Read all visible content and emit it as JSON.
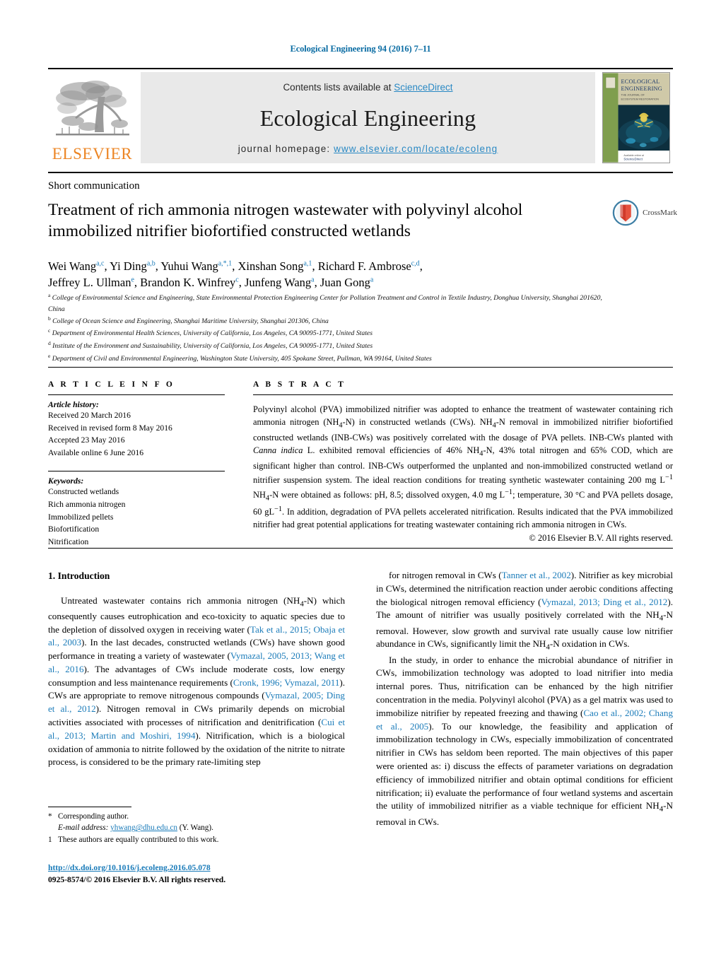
{
  "running_head": "Ecological Engineering 94 (2016) 7–11",
  "masthead": {
    "publisher_name": "ELSEVIER",
    "contents_prefix": "Contents lists available at ",
    "sciencedirect_link": "ScienceDirect",
    "journal_name": "Ecological Engineering",
    "homepage_prefix": "journal homepage: ",
    "homepage_link": "www.elsevier.com/locate/ecoleng",
    "cover_title_line1": "ECOLOGICAL",
    "cover_title_line2": "ENGINEERING"
  },
  "article": {
    "type": "Short communication",
    "title": "Treatment of rich ammonia nitrogen wastewater with polyvinyl alcohol immobilized nitrifier biofortified constructed wetlands",
    "crossmark_label": "CrossMark",
    "authors_line1": "Wei Wang<sup>a,c</sup>, Yi Ding<sup>a,b</sup>, Yuhui Wang<sup>a,*,1</sup>, Xinshan Song<sup>a,1</sup>, Richard F. Ambrose<sup>c,d</sup>,",
    "authors_line2": "Jeffrey L. Ullman<sup>e</sup>, Brandon K. Winfrey<sup>c</sup>, Junfeng Wang<sup>a</sup>, Juan Gong<sup>a</sup>",
    "affiliations": [
      "<sup>a</sup> College of Environmental Science and Engineering, State Environmental Protection Engineering Center for Pollution Treatment and Control in Textile Industry, Donghua University, Shanghai 201620, China",
      "<sup>b</sup> College of Ocean Science and Engineering, Shanghai Maritime University, Shanghai 201306, China",
      "<sup>c</sup> Department of Environmental Health Sciences, University of California, Los Angeles, CA 90095-1771, United States",
      "<sup>d</sup> Institute of the Environment and Sustainability, University of California, Los Angeles, CA 90095-1771, United States",
      "<sup>e</sup> Department of Civil and Environmental Engineering, Washington State University, 405 Spokane Street, Pullman, WA 99164, United States"
    ]
  },
  "article_info": {
    "heading": "A R T I C L E   I N F O",
    "history_label": "Article history:",
    "history": [
      "Received 20 March 2016",
      "Received in revised form 8 May 2016",
      "Accepted 23 May 2016",
      "Available online 6 June 2016"
    ],
    "keywords_label": "Keywords:",
    "keywords": [
      "Constructed wetlands",
      "Rich ammonia nitrogen",
      "Immobilized pellets",
      "Biofortification",
      "Nitrification"
    ]
  },
  "abstract": {
    "heading": "A B S T R A C T",
    "text": "Polyvinyl alcohol (PVA) immobilized nitrifier was adopted to enhance the treatment of wastewater containing rich ammonia nitrogen (NH<sub>4</sub>-N) in constructed wetlands (CWs). NH<sub>4</sub>-N removal in immobilized nitrifier biofortified constructed wetlands (INB-CWs) was positively correlated with the dosage of PVA pellets. INB-CWs planted with <i>Canna indica</i> L. exhibited removal efficiencies of 46% NH<sub>4</sub>-N, 43% total nitrogen and 65% COD, which are significant higher than control. INB-CWs outperformed the unplanted and non-immobilized constructed wetland or nitrifier suspension system. The ideal reaction conditions for treating synthetic wastewater containing 200 mg L<sup>−1</sup> NH<sub>4</sub>-N were obtained as follows: pH, 8.5; dissolved oxygen, 4.0 mg L<sup>−1</sup>; temperature, 30 °C and PVA pellets dosage, 60 gL<sup>−1</sup>. In addition, degradation of PVA pellets accelerated nitrification. Results indicated that the PVA immobilized nitrifier had great potential applications for treating wastewater containing rich ammonia nitrogen in CWs.",
    "copyright": "© 2016 Elsevier B.V. All rights reserved."
  },
  "body": {
    "section_heading": "1.  Introduction",
    "left_paragraphs": [
      "Untreated wastewater contains rich ammonia nitrogen (NH<sub>4</sub>-N) which consequently causes eutrophication and eco-toxicity to aquatic species due to the depletion of dissolved oxygen in receiving water (<span class=\"ref\">Tak et al., 2015; Obaja et al., 2003</span>). In the last decades, constructed wetlands (CWs) have shown good performance in treating a variety of wastewater (<span class=\"ref\">Vymazal, 2005, 2013; Wang et al., 2016</span>). The advantages of CWs include moderate costs, low energy consumption and less maintenance requirements (<span class=\"ref\">Cronk, 1996; Vymazal, 2011</span>). CWs are appropriate to remove nitrogenous compounds (<span class=\"ref\">Vymazal, 2005; Ding et al., 2012</span>). Nitrogen removal in CWs primarily depends on microbial activities associated with processes of nitrification and denitrification (<span class=\"ref\">Cui et al., 2013; Martin and Moshiri, 1994</span>). Nitrification, which is a biological oxidation of ammonia to nitrite followed by the oxidation of the nitrite to nitrate process, is considered to be the primary rate-limiting step"
    ],
    "right_paragraphs": [
      "for nitrogen removal in CWs (<span class=\"ref\">Tanner et al., 2002</span>). Nitrifier as key microbial in CWs, determined the nitrification reaction under aerobic conditions affecting the biological nitrogen removal efficiency (<span class=\"ref\">Vymazal, 2013; Ding et al., 2012</span>). The amount of nitrifier was usually positively correlated with the NH<sub>4</sub>-N removal. However, slow growth and survival rate usually cause low nitrifier abundance in CWs, significantly limit the NH<sub>4</sub>-N oxidation in CWs.",
      "In the study, in order to enhance the microbial abundance of nitrifier in CWs, immobilization technology was adopted to load nitrifier into media internal pores. Thus, nitrification can be enhanced by the high nitrifier concentration in the media. Polyvinyl alcohol (PVA) as a gel matrix was used to immobilize nitrifier by repeated freezing and thawing (<span class=\"ref\">Cao et al., 2002; Chang et al., 2005</span>). To our knowledge, the feasibility and application of immobilization technology in CWs, especially immobilization of concentrated nitrifier in CWs has seldom been reported. The main objectives of this paper were oriented as: i) discuss the effects of parameter variations on degradation efficiency of immobilized nitrifier and obtain optimal conditions for efficient nitrification; ii) evaluate the performance of four wetland systems and ascertain the utility of immobilized nitrifier as a viable technique for efficient NH<sub>4</sub>-N removal in CWs."
    ]
  },
  "footnotes": {
    "corresponding_mark": "*",
    "corresponding_text": "Corresponding author.",
    "email_label": "E-mail address:",
    "email": "yhwang@dhu.edu.cn",
    "email_suffix": "(Y. Wang).",
    "equal_mark": "1",
    "equal_text": "These authors are equally contributed to this work."
  },
  "footer": {
    "doi": "http://dx.doi.org/10.1016/j.ecoleng.2016.05.078",
    "issn_line": "0925-8574/© 2016 Elsevier B.V. All rights reserved."
  },
  "colors": {
    "link_blue": "#1a7bb9",
    "sciencedirect_blue": "#2a89c4",
    "elsevier_orange": "#ec8524",
    "band_gray": "#e9e9e9"
  }
}
